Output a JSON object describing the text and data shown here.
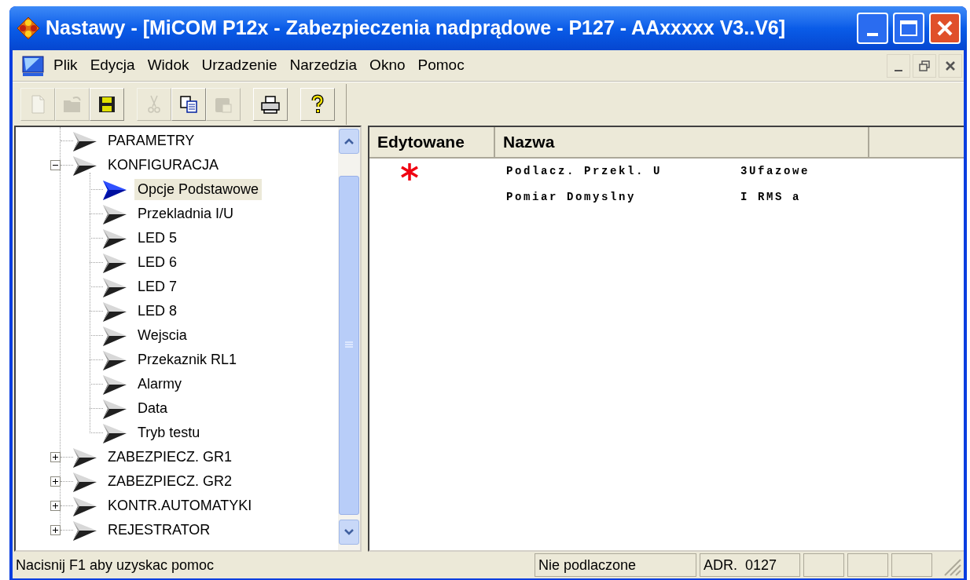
{
  "window": {
    "title": "Nastawy - [MiCOM P12x - Zabezpieczenia nadprądowe - P127 - AAxxxxx V3..V6]"
  },
  "menu": [
    "Plik",
    "Edycja",
    "Widok",
    "Urzadzenie",
    "Narzedzia",
    "Okno",
    "Pomoc"
  ],
  "toolbar": [
    {
      "kind": "new",
      "disabled": true
    },
    {
      "kind": "open",
      "disabled": true
    },
    {
      "kind": "save",
      "disabled": false
    },
    {
      "kind": "cut",
      "disabled": true
    },
    {
      "kind": "copy",
      "disabled": false
    },
    {
      "kind": "paste",
      "disabled": true
    },
    {
      "kind": "print",
      "disabled": false
    },
    {
      "kind": "help",
      "disabled": false
    }
  ],
  "tree": [
    {
      "label": "PARAMETRY",
      "selected": false
    },
    {
      "label": "KONFIGURACJA",
      "selected": false,
      "expanded": true,
      "children": [
        {
          "label": "Opcje Podstawowe",
          "selected": true
        },
        {
          "label": "Przekladnia I/U",
          "selected": false
        },
        {
          "label": "LED 5",
          "selected": false
        },
        {
          "label": "LED 6",
          "selected": false
        },
        {
          "label": "LED 7",
          "selected": false
        },
        {
          "label": "LED 8",
          "selected": false
        },
        {
          "label": "Wejscia",
          "selected": false
        },
        {
          "label": "Przekaznik RL1",
          "selected": false
        },
        {
          "label": "Alarmy",
          "selected": false
        },
        {
          "label": "Data",
          "selected": false
        },
        {
          "label": "Tryb testu",
          "selected": false
        }
      ]
    },
    {
      "label": "ZABEZPIECZ. GR1",
      "selected": false,
      "expanded": false
    },
    {
      "label": "ZABEZPIECZ. GR2",
      "selected": false,
      "expanded": false
    },
    {
      "label": "KONTR.AUTOMATYKI",
      "selected": false,
      "expanded": false
    },
    {
      "label": "REJESTRATOR",
      "selected": false,
      "expanded": false
    }
  ],
  "table": {
    "columns": [
      "Edytowane",
      "Nazwa"
    ],
    "rows": [
      {
        "edited": true,
        "name": "Podlacz. Przekl. U",
        "value": "3Ufazowe"
      },
      {
        "edited": false,
        "name": "Pomiar Domyslny",
        "value": "I RMS a"
      }
    ]
  },
  "status_bar": {
    "message": "Nacisnij F1 aby uzyskac pomoc",
    "panes": [
      "Nie podlaczone",
      "ADR.  0127"
    ]
  }
}
